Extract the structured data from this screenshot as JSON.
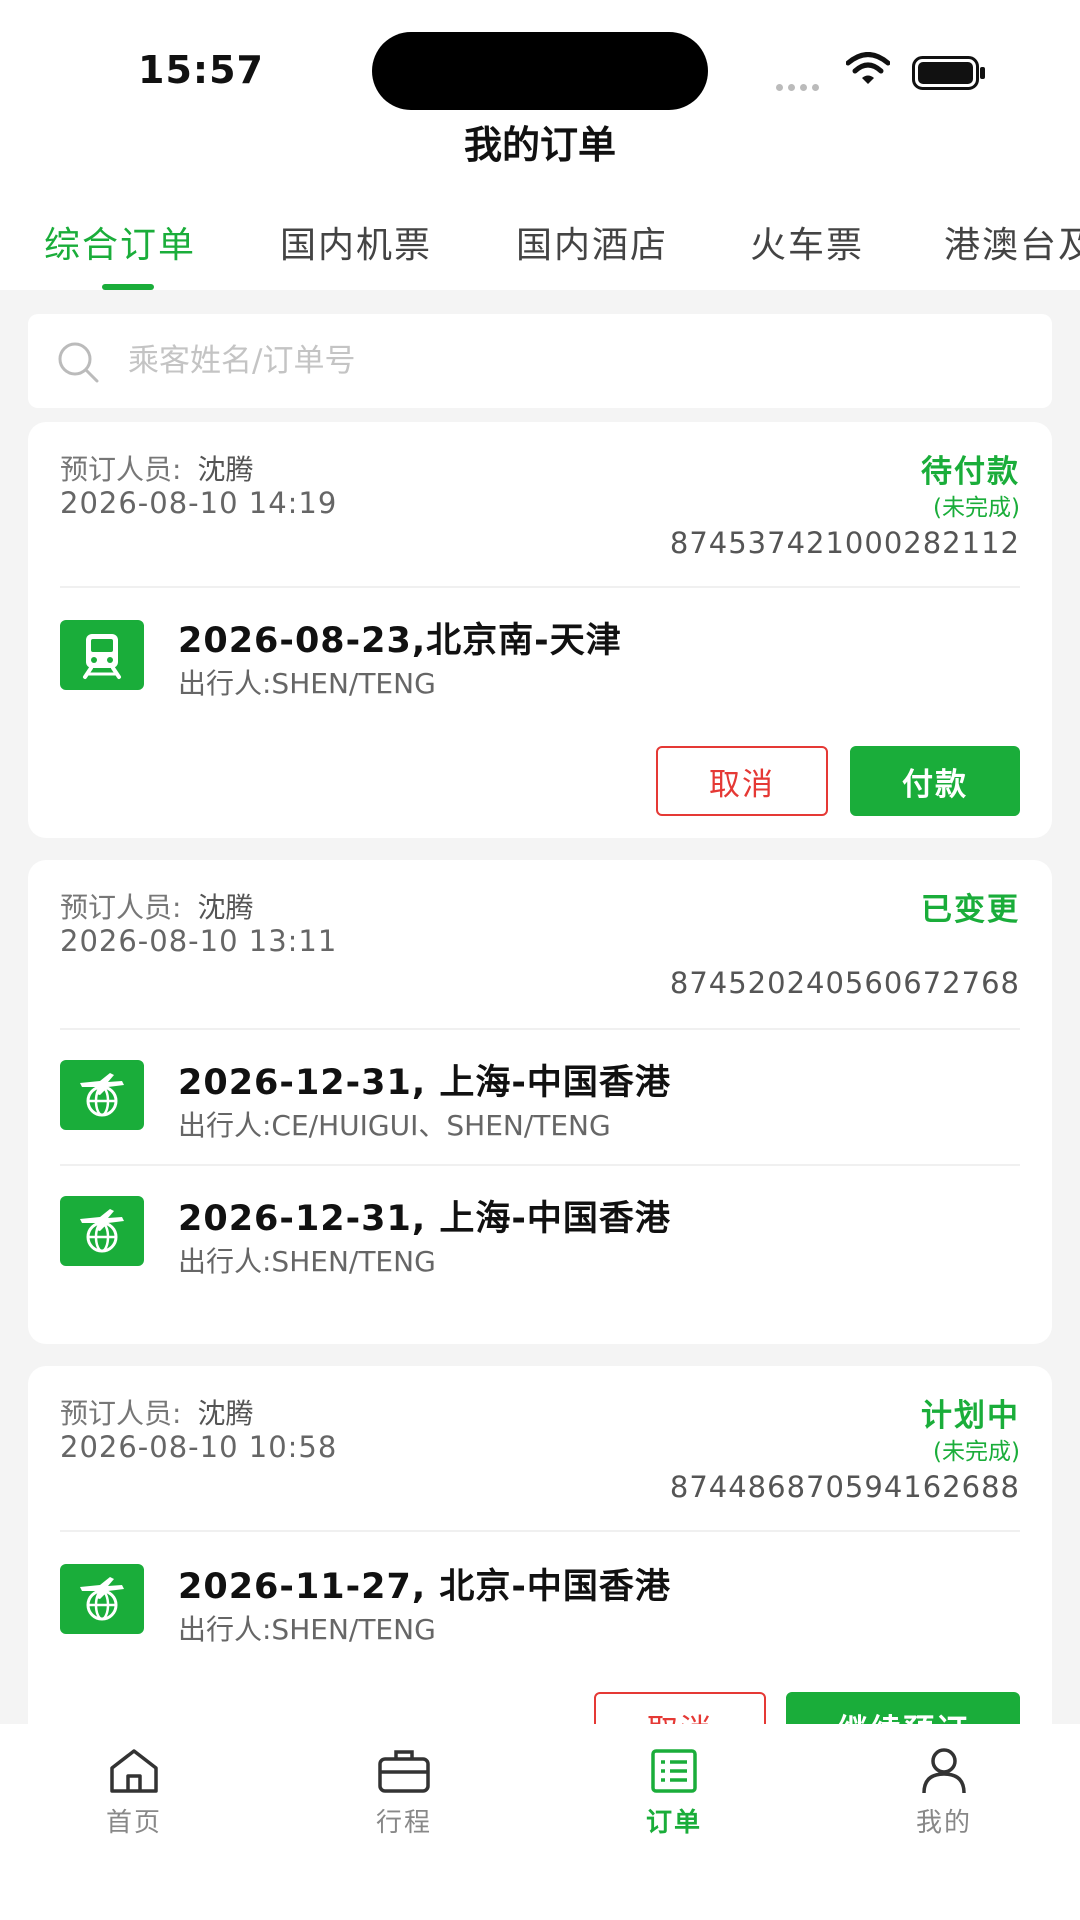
{
  "status_bar": {
    "time": "15:57"
  },
  "nav": {
    "title": "我的订单"
  },
  "tabs": [
    {
      "label": "综合订单",
      "active": true
    },
    {
      "label": "国内机票",
      "active": false
    },
    {
      "label": "国内酒店",
      "active": false
    },
    {
      "label": "火车票",
      "active": false
    },
    {
      "label": "港澳台及国际机票",
      "active": false
    }
  ],
  "search": {
    "placeholder": "乘客姓名/订单号"
  },
  "orders": [
    {
      "booker_label": "预订人员:",
      "booker_name": "沈腾",
      "booked_time": "2026-08-10 14:19",
      "status": "待付款",
      "substatus": "(未完成)",
      "order_no": "874537421000282112",
      "items": [
        {
          "icon": "train-icon",
          "title": "2026-08-23,北京南-天津",
          "traveler": "出行人:SHEN/TENG"
        }
      ],
      "actions": [
        "取消",
        "付款"
      ]
    },
    {
      "booker_label": "预订人员:",
      "booker_name": "沈腾",
      "booked_time": "2026-08-10 13:11",
      "status": "已变更",
      "substatus": "",
      "order_no": "874520240560672768",
      "items": [
        {
          "icon": "international-flight-icon",
          "title": "2026-12-31, 上海-中国香港",
          "traveler": "出行人:CE/HUIGUI、SHEN/TENG"
        },
        {
          "icon": "international-flight-icon",
          "title": "2026-12-31, 上海-中国香港",
          "traveler": "出行人:SHEN/TENG"
        }
      ],
      "actions": []
    },
    {
      "booker_label": "预订人员:",
      "booker_name": "沈腾",
      "booked_time": "2026-08-10 10:58",
      "status": "计划中",
      "substatus": "(未完成)",
      "order_no": "874486870594162688",
      "items": [
        {
          "icon": "international-flight-icon",
          "title": "2026-11-27, 北京-中国香港",
          "traveler": "出行人:SHEN/TENG"
        }
      ],
      "actions": [
        "取消",
        "继续预订"
      ]
    }
  ],
  "bottom_tabs": [
    {
      "label": "首页",
      "icon": "home-icon",
      "active": false
    },
    {
      "label": "行程",
      "icon": "briefcase-icon",
      "active": false
    },
    {
      "label": "订单",
      "icon": "order-list-icon",
      "active": true
    },
    {
      "label": "我的",
      "icon": "user-icon",
      "active": false
    }
  ],
  "colors": {
    "accent": "#1aad3a",
    "danger": "#e53935",
    "background": "#f4f4f4"
  }
}
